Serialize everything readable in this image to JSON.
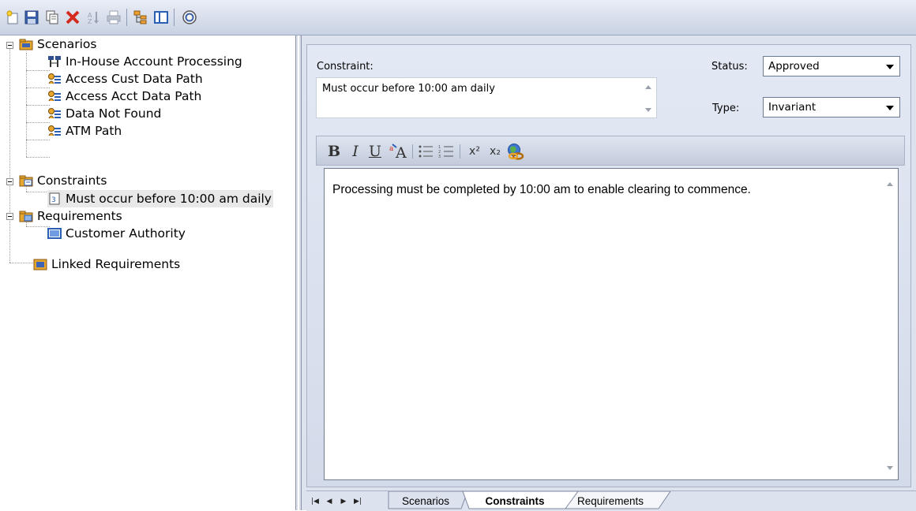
{
  "toolbar": {
    "buttons": [
      {
        "icon": "new-item-icon"
      },
      {
        "icon": "save-icon"
      },
      {
        "icon": "copy-icon"
      },
      {
        "icon": "delete-icon"
      },
      {
        "icon": "sort-icon"
      },
      {
        "icon": "print-icon"
      },
      {
        "icon": "tree-view-icon"
      },
      {
        "icon": "layout-icon"
      },
      {
        "icon": "help-icon"
      }
    ]
  },
  "tree": {
    "scenarios": {
      "label": "Scenarios",
      "icon": "scenarios-folder-icon"
    },
    "scenario_items": [
      {
        "label": "In-House Account Processing",
        "icon": "basic-path-icon"
      },
      {
        "label": "Access Cust Data Path",
        "icon": "alternate-path-icon"
      },
      {
        "label": "Access Acct Data Path",
        "icon": "alternate-path-icon"
      },
      {
        "label": "Data Not Found",
        "icon": "alternate-path-icon"
      },
      {
        "label": "ATM Path",
        "icon": "alternate-path-icon"
      }
    ],
    "constraints": {
      "label": "Constraints",
      "icon": "constraints-folder-icon"
    },
    "constraint_items": [
      {
        "label": "Must occur before 10:00 am daily",
        "icon": "constraint-item-icon"
      }
    ],
    "requirements": {
      "label": "Requirements",
      "icon": "requirements-folder-icon"
    },
    "requirement_items": [
      {
        "label": "Customer Authority",
        "icon": "requirement-item-icon"
      }
    ],
    "linked": {
      "label": "Linked Requirements",
      "icon": "linked-requirements-icon"
    }
  },
  "form": {
    "constraint_label": "Constraint:",
    "constraint_value": "Must occur before 10:00 am daily",
    "status_label": "Status:",
    "status_value": "Approved",
    "type_label": "Type:",
    "type_value": "Invariant"
  },
  "formatting": {
    "bold": "B",
    "italic": "I",
    "underline": "U",
    "superscript": "x²",
    "subscript": "x₂"
  },
  "notes": {
    "text": "Processing must be completed by 10:00 am to enable clearing to commence."
  },
  "tabs": [
    {
      "label": "Scenarios"
    },
    {
      "label": "Constraints"
    },
    {
      "label": "Requirements"
    }
  ],
  "active_tab": "Constraints",
  "colors": {
    "toolbar_bg": "#d4dbe8",
    "panel_bg": "#dde3ee",
    "accent_blue": "#2b5fb4",
    "folder_orange": "#e39a2a"
  }
}
